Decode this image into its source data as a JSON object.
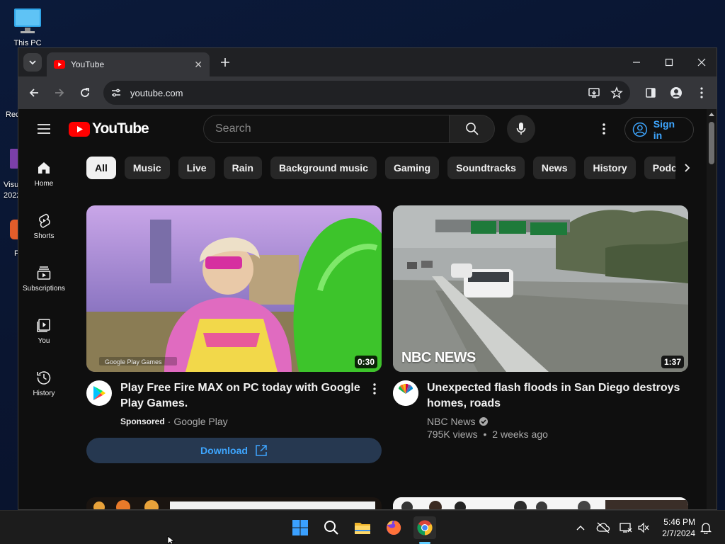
{
  "desktop": {
    "icons": [
      {
        "label": "This PC"
      }
    ],
    "clipped_labels": [
      "Rec",
      "Visu",
      "2022",
      "F"
    ]
  },
  "browser": {
    "tab_title": "YouTube",
    "url": "youtube.com",
    "window_controls": [
      "minimize",
      "maximize",
      "close"
    ]
  },
  "youtube": {
    "logo_text": "YouTube",
    "search_placeholder": "Search",
    "signin_label": "Sign in",
    "sidenav": [
      {
        "label": "Home",
        "icon": "home-icon"
      },
      {
        "label": "Shorts",
        "icon": "shorts-icon"
      },
      {
        "label": "Subscriptions",
        "icon": "subscriptions-icon"
      },
      {
        "label": "You",
        "icon": "you-icon"
      },
      {
        "label": "History",
        "icon": "history-icon"
      }
    ],
    "chips": [
      "All",
      "Music",
      "Live",
      "Rain",
      "Background music",
      "Gaming",
      "Soundtracks",
      "News",
      "History",
      "Podca"
    ],
    "videos": [
      {
        "title": "Play Free Fire MAX on PC today with Google Play Games.",
        "sponsored": "Sponsored",
        "channel": "Google Play",
        "duration": "0:30",
        "thumb_watermark": "Google Play Games",
        "cta": "Download"
      },
      {
        "title": "Unexpected flash floods in San Diego destroys homes, roads",
        "channel": "NBC News",
        "verified": true,
        "views": "795K views",
        "age": "2 weeks ago",
        "duration": "1:37",
        "thumb_watermark": "NBC NEWS",
        "avatar_text": "NBC NEWS"
      }
    ]
  },
  "taskbar": {
    "time": "5:46 PM",
    "date": "2/7/2024",
    "pinned": [
      "start-icon",
      "search-icon",
      "file-explorer-icon",
      "firefox-icon",
      "chrome-icon"
    ],
    "active": "chrome-icon"
  },
  "colors": {
    "yt_red": "#ff0000",
    "link_blue": "#3ea6ff",
    "page_bg": "#0f0f0f",
    "chip_bg": "#272727"
  }
}
